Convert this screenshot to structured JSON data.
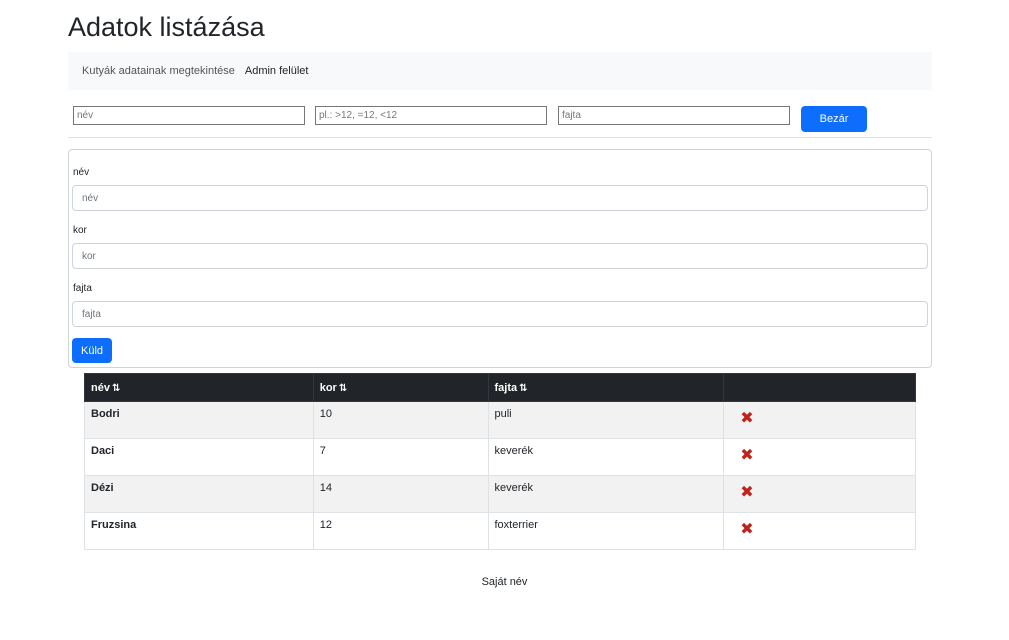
{
  "page": {
    "title": "Adatok listázása"
  },
  "nav": {
    "items": [
      {
        "label": "Kutyák adatainak megtekintése"
      },
      {
        "label": "Admin felület"
      }
    ]
  },
  "filters": {
    "name_placeholder": "név",
    "age_placeholder": "pl.: >12, =12, <12",
    "breed_placeholder": "fajta",
    "close_label": "Bezár"
  },
  "form": {
    "name_label": "név",
    "name_placeholder": "név",
    "age_label": "kor",
    "age_placeholder": "kor",
    "breed_label": "fajta",
    "breed_placeholder": "fajta",
    "submit_label": "Küld"
  },
  "table": {
    "headers": [
      "név",
      "kor",
      "fajta",
      ""
    ],
    "sort_icon": "⇅",
    "delete_icon": "✖",
    "rows": [
      {
        "name": "Bodri",
        "age": "10",
        "breed": "puli"
      },
      {
        "name": "Daci",
        "age": "7",
        "breed": "keverék"
      },
      {
        "name": "Dézi",
        "age": "14",
        "breed": "keverék"
      },
      {
        "name": "Fruzsina",
        "age": "12",
        "breed": "foxterrier"
      }
    ]
  },
  "footer": {
    "text": "Saját név"
  },
  "colors": {
    "primary": "#0d6efd",
    "table_header": "#212529",
    "delete": "#c0231a"
  }
}
